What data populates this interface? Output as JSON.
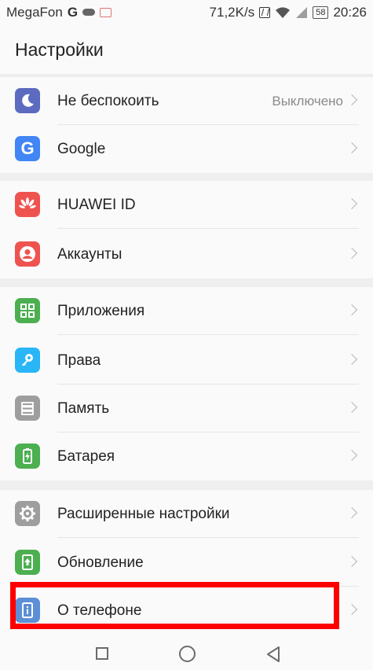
{
  "status_bar": {
    "carrier": "MegaFon",
    "network": "G",
    "speed": "71,2K/s",
    "battery": "58",
    "time": "20:26"
  },
  "header": {
    "title": "Настройки"
  },
  "settings": {
    "dnd": {
      "label": "Не беспокоить",
      "value": "Выключено",
      "color": "#5c6bc0"
    },
    "google": {
      "label": "Google",
      "color": "#4285f4"
    },
    "huawei_id": {
      "label": "HUAWEI ID",
      "color": "#ef5350"
    },
    "accounts": {
      "label": "Аккаунты",
      "color": "#ef5350"
    },
    "apps": {
      "label": "Приложения",
      "color": "#4caf50"
    },
    "permissions": {
      "label": "Права",
      "color": "#29b6f6"
    },
    "memory": {
      "label": "Память",
      "color": "#9e9e9e"
    },
    "battery": {
      "label": "Батарея",
      "color": "#4caf50"
    },
    "advanced": {
      "label": "Расширенные настройки",
      "color": "#9e9e9e"
    },
    "update": {
      "label": "Обновление",
      "color": "#4caf50"
    },
    "about": {
      "label": "О телефоне",
      "color": "#5c8fd6"
    }
  },
  "highlight_color": "#ff0000"
}
